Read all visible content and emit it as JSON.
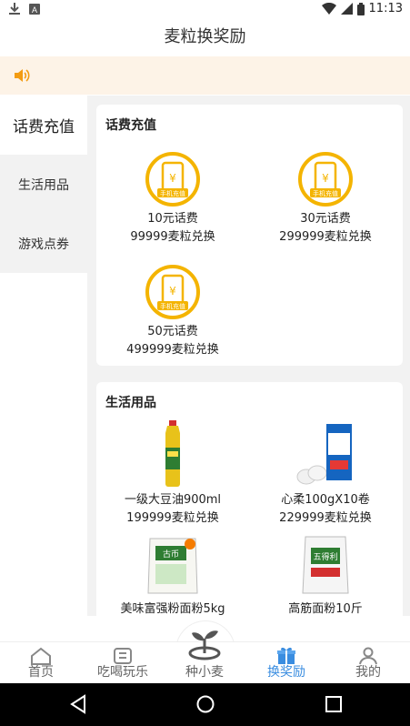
{
  "status_bar": {
    "time": "11:13"
  },
  "header": {
    "title": "麦粒换奖励"
  },
  "sidebar": {
    "items": [
      {
        "label": "话费充值"
      },
      {
        "label": "生活用品"
      },
      {
        "label": "游戏点券"
      }
    ]
  },
  "sections": [
    {
      "title": "话费充值",
      "items": [
        {
          "name": "10元话费",
          "price": "99999麦粒兑换",
          "icon": "phone-recharge-icon",
          "icon_text": "手机充值"
        },
        {
          "name": "30元话费",
          "price": "299999麦粒兑换",
          "icon": "phone-recharge-icon",
          "icon_text": "手机充值"
        },
        {
          "name": "50元话费",
          "price": "499999麦粒兑换",
          "icon": "phone-recharge-icon",
          "icon_text": "手机充值"
        }
      ]
    },
    {
      "title": "生活用品",
      "items": [
        {
          "name": "一级大豆油900ml",
          "price": "199999麦粒兑换",
          "icon": "soybean-oil-image"
        },
        {
          "name": "心柔100gX10卷",
          "price": "229999麦粒兑换",
          "icon": "tissue-rolls-image"
        },
        {
          "name": "美味富强粉面粉5kg",
          "price": "",
          "icon": "flour-bag-image",
          "package_text": "古币"
        },
        {
          "name": "高筋面粉10斤",
          "price": "",
          "icon": "high-gluten-flour-image",
          "package_text": "五得利"
        }
      ]
    }
  ],
  "tab_bar": {
    "tabs": [
      {
        "label": "首页",
        "icon": "home-icon"
      },
      {
        "label": "吃喝玩乐",
        "icon": "fun-icon"
      },
      {
        "label": "种小麦",
        "icon": "sprout-icon"
      },
      {
        "label": "换奖励",
        "icon": "gift-icon",
        "active": true
      },
      {
        "label": "我的",
        "icon": "profile-icon"
      }
    ]
  },
  "colors": {
    "accent": "#3a8de0",
    "coin": "#f4b400",
    "notice_bg": "#fdf3e7",
    "speaker": "#f39c12"
  }
}
